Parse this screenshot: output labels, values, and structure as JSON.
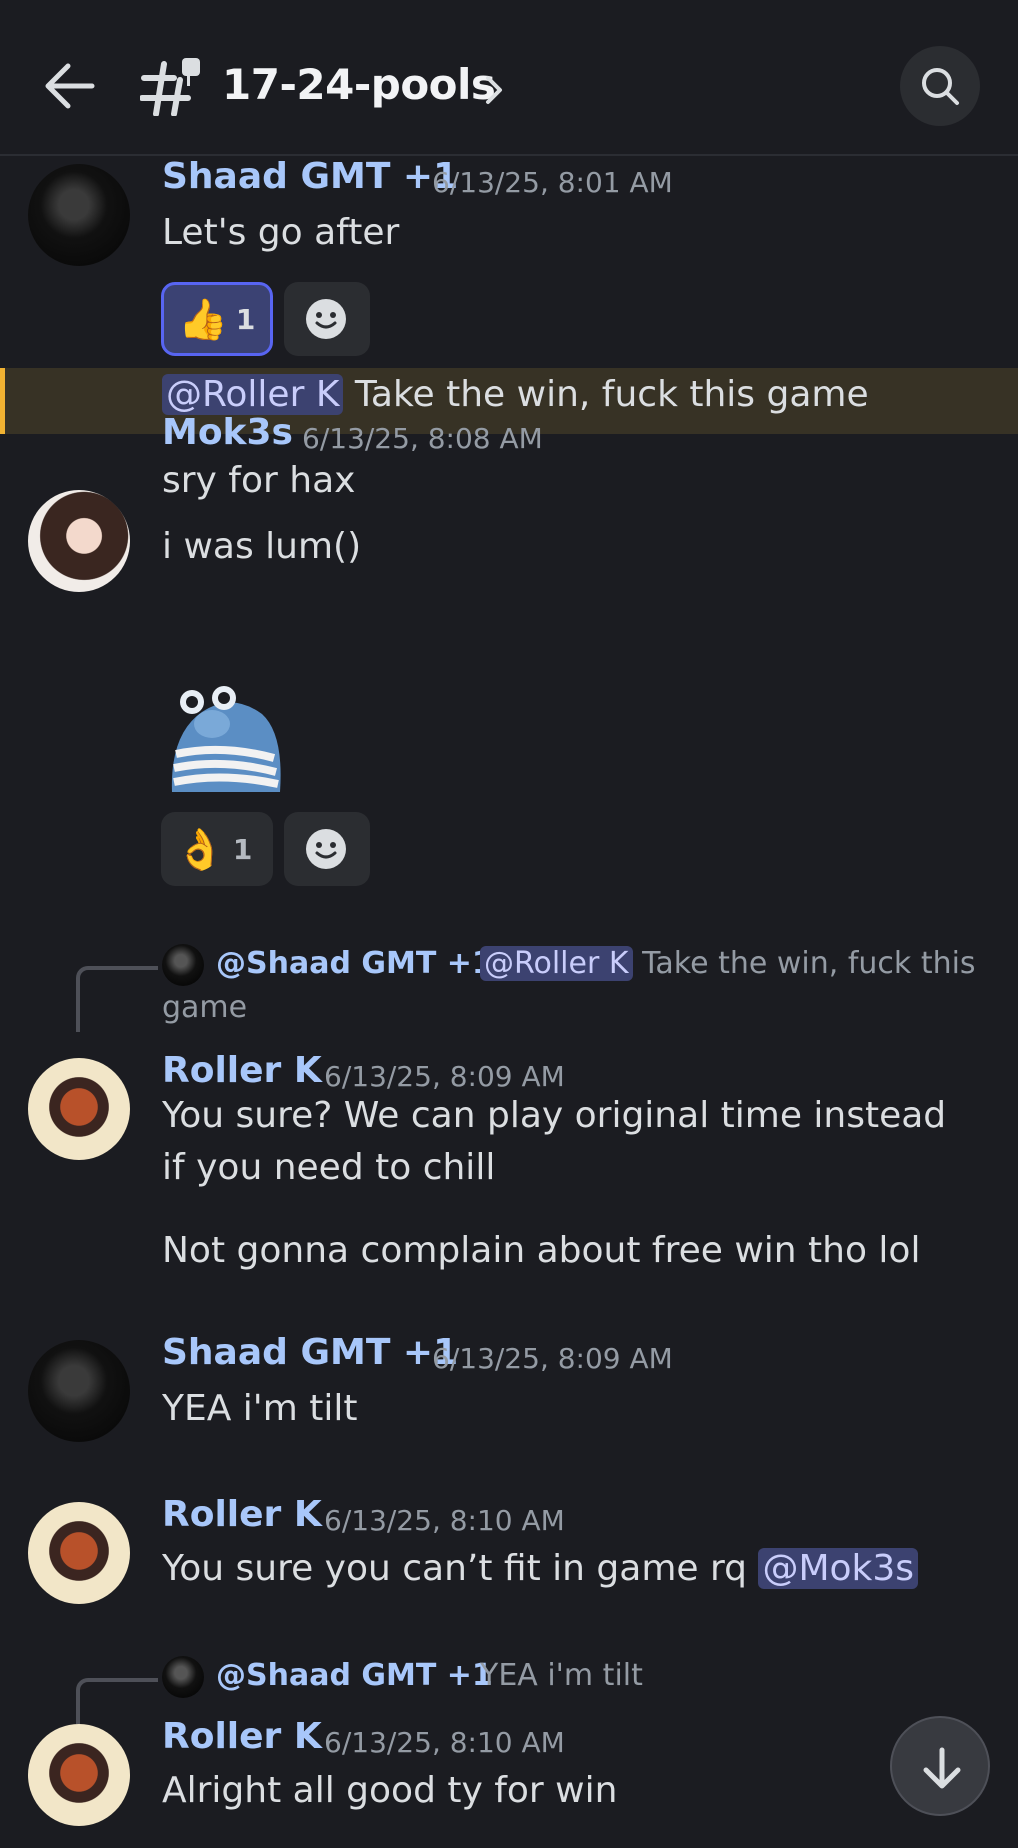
{
  "header": {
    "channel_name": "17-24-pools",
    "icons": {
      "back": "arrow-left-icon",
      "channel": "hash-thread-icon",
      "chevron": "chevron-right-icon",
      "search": "search-icon"
    }
  },
  "messages": [
    {
      "author": "Shaad GMT +1",
      "time": "6/13/25, 8:01 AM",
      "lines": [
        "Let's go after"
      ],
      "reactions": [
        {
          "emoji": "👍",
          "count": "1",
          "active": true
        }
      ],
      "continuation": {
        "mention": "@Roller K",
        "text": " Take the win, fuck this game"
      }
    },
    {
      "author": "Mok3s",
      "time": "6/13/25, 8:08 AM",
      "lines": [
        "sry for hax",
        "i was lum()"
      ],
      "sticker": "frog-sticker",
      "reactions": [
        {
          "emoji": "👌",
          "count": "1",
          "active": false
        }
      ]
    },
    {
      "reply": {
        "name": "@Shaad GMT +1",
        "mention": "@Roller K",
        "text": " Take the win, fuck this",
        "text2": "game"
      },
      "author": "Roller K",
      "time": "6/13/25, 8:09 AM",
      "lines": [
        "You sure? We can play original time instead if you need to chill",
        "Not gonna complain about free win tho lol"
      ]
    },
    {
      "author": "Shaad GMT +1",
      "time": "6/13/25, 8:09 AM",
      "lines": [
        "YEA i'm tilt"
      ]
    },
    {
      "author": "Roller K",
      "time": "6/13/25, 8:10 AM",
      "lines": [
        "You sure you can’t fit in game rq "
      ],
      "mention": "@Mok3s"
    },
    {
      "reply": {
        "name": "@Shaad GMT +1",
        "text": "YEA i'm tilt"
      },
      "author": "Roller K",
      "time": "6/13/25, 8:10 AM",
      "lines": [
        "Alright all good ty for win"
      ]
    }
  ],
  "colors": {
    "background": "#1b1c21",
    "username": "#a8c7fa",
    "mention_bg": "#3c4270",
    "highlight_bar": "#f0b232",
    "reaction_active_border": "#5865f2"
  }
}
